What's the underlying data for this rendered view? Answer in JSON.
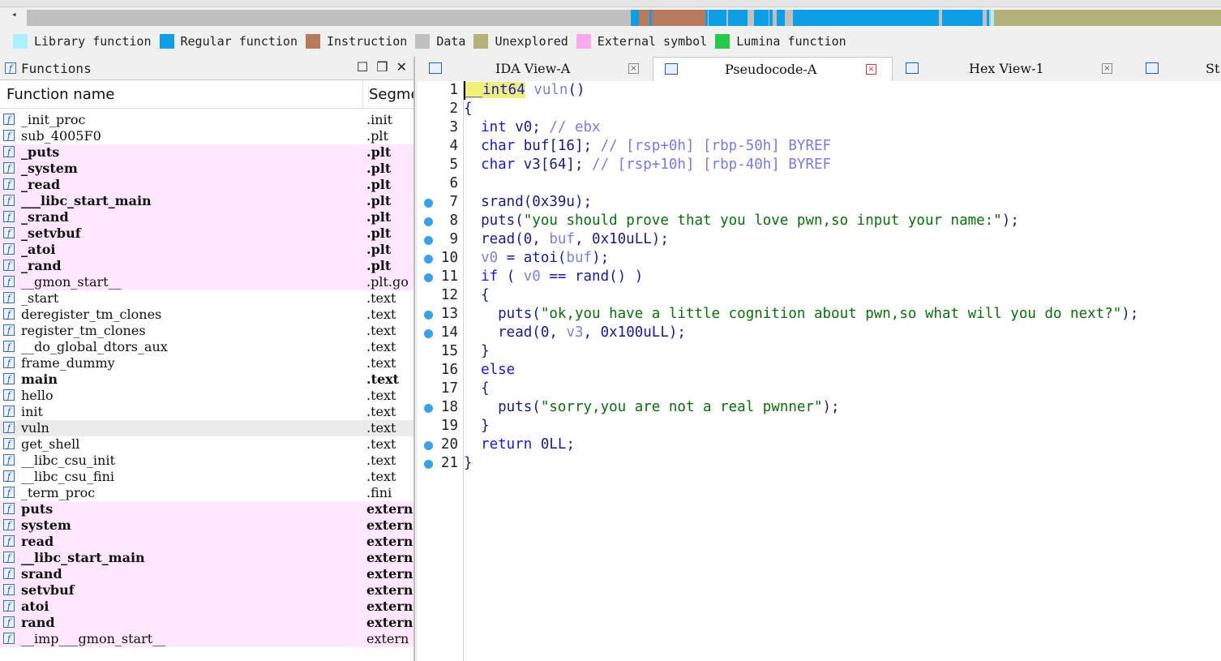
{
  "navbar": {
    "colors": {
      "library": "#aaf0f8",
      "regular": "#0d9ee6",
      "instruction": "#b87a5c",
      "data": "#c0c0c0",
      "unexplored": "#b5b17a",
      "external": "#ffa8f0",
      "lumina": "#2ac84a"
    }
  },
  "legend": [
    {
      "label": "Library function",
      "color": "#aaf0f8"
    },
    {
      "label": "Regular function",
      "color": "#0d9ee6"
    },
    {
      "label": "Instruction",
      "color": "#b87a5c"
    },
    {
      "label": "Data",
      "color": "#c0c0c0"
    },
    {
      "label": "Unexplored",
      "color": "#b5b17a"
    },
    {
      "label": "External symbol",
      "color": "#ffa8f0"
    },
    {
      "label": "Lumina function",
      "color": "#2ac84a"
    }
  ],
  "functions_panel": {
    "title": "Functions",
    "col_name": "Function name",
    "col_segment": "Segme",
    "rows": [
      {
        "name": "_init_proc",
        "seg": ".init",
        "style": ""
      },
      {
        "name": "sub_4005F0",
        "seg": ".plt",
        "style": ""
      },
      {
        "name": "_puts",
        "seg": ".plt",
        "style": "ext bold"
      },
      {
        "name": "_system",
        "seg": ".plt",
        "style": "ext bold"
      },
      {
        "name": "_read",
        "seg": ".plt",
        "style": "ext bold"
      },
      {
        "name": "___libc_start_main",
        "seg": ".plt",
        "style": "ext bold"
      },
      {
        "name": "_srand",
        "seg": ".plt",
        "style": "ext bold"
      },
      {
        "name": "_setvbuf",
        "seg": ".plt",
        "style": "ext bold"
      },
      {
        "name": "_atoi",
        "seg": ".plt",
        "style": "ext bold"
      },
      {
        "name": "_rand",
        "seg": ".plt",
        "style": "ext bold"
      },
      {
        "name": "__gmon_start__",
        "seg": ".plt.go",
        "style": "ext"
      },
      {
        "name": "_start",
        "seg": ".text",
        "style": ""
      },
      {
        "name": "deregister_tm_clones",
        "seg": ".text",
        "style": ""
      },
      {
        "name": "register_tm_clones",
        "seg": ".text",
        "style": ""
      },
      {
        "name": "__do_global_dtors_aux",
        "seg": ".text",
        "style": ""
      },
      {
        "name": "frame_dummy",
        "seg": ".text",
        "style": ""
      },
      {
        "name": "main",
        "seg": ".text",
        "style": "bold"
      },
      {
        "name": "hello",
        "seg": ".text",
        "style": ""
      },
      {
        "name": "init",
        "seg": ".text",
        "style": ""
      },
      {
        "name": "vuln",
        "seg": ".text",
        "style": "sel"
      },
      {
        "name": "get_shell",
        "seg": ".text",
        "style": ""
      },
      {
        "name": "__libc_csu_init",
        "seg": ".text",
        "style": ""
      },
      {
        "name": "__libc_csu_fini",
        "seg": ".text",
        "style": ""
      },
      {
        "name": "_term_proc",
        "seg": ".fini",
        "style": ""
      },
      {
        "name": "puts",
        "seg": "extern",
        "style": "ext bold"
      },
      {
        "name": "system",
        "seg": "extern",
        "style": "ext bold"
      },
      {
        "name": "read",
        "seg": "extern",
        "style": "ext bold"
      },
      {
        "name": "__libc_start_main",
        "seg": "extern",
        "style": "ext bold"
      },
      {
        "name": "srand",
        "seg": "extern",
        "style": "ext bold"
      },
      {
        "name": "setvbuf",
        "seg": "extern",
        "style": "ext bold"
      },
      {
        "name": "atoi",
        "seg": "extern",
        "style": "ext bold"
      },
      {
        "name": "rand",
        "seg": "extern",
        "style": "ext bold"
      },
      {
        "name": "__imp___gmon_start__",
        "seg": "extern",
        "style": "ext"
      }
    ]
  },
  "tabs": [
    {
      "label": "IDA View-A",
      "active": false
    },
    {
      "label": "Pseudocode-A",
      "active": true
    },
    {
      "label": "Hex View-1",
      "active": false
    },
    {
      "label": "St",
      "active": false
    }
  ],
  "pseudocode": {
    "lines": [
      {
        "n": "1",
        "dot": false,
        "tokens": [
          [
            "hl k",
            "__int64"
          ],
          [
            "v",
            " vuln"
          ],
          [
            "p",
            "()"
          ]
        ]
      },
      {
        "n": "2",
        "dot": false,
        "tokens": [
          [
            "p",
            "{"
          ]
        ]
      },
      {
        "n": "3",
        "dot": false,
        "tokens": [
          [
            "k",
            "  int"
          ],
          [
            "n",
            " v0; "
          ],
          [
            "c",
            "// ebx"
          ]
        ]
      },
      {
        "n": "4",
        "dot": false,
        "tokens": [
          [
            "k",
            "  char"
          ],
          [
            "n",
            " buf[16]; "
          ],
          [
            "c",
            "// [rsp+0h] [rbp-50h] BYREF"
          ]
        ]
      },
      {
        "n": "5",
        "dot": false,
        "tokens": [
          [
            "k",
            "  char"
          ],
          [
            "n",
            " v3[64]; "
          ],
          [
            "c",
            "// [rsp+10h] [rbp-40h] BYREF"
          ]
        ]
      },
      {
        "n": "6",
        "dot": false,
        "tokens": []
      },
      {
        "n": "7",
        "dot": true,
        "tokens": [
          [
            "n",
            "  srand(0x39u);"
          ]
        ]
      },
      {
        "n": "8",
        "dot": true,
        "tokens": [
          [
            "n",
            "  puts("
          ],
          [
            "s",
            "\"you should prove that you love pwn,so input your name:\""
          ],
          [
            "n",
            ");"
          ]
        ]
      },
      {
        "n": "9",
        "dot": true,
        "tokens": [
          [
            "n",
            "  read(0, "
          ],
          [
            "v",
            "buf"
          ],
          [
            "n",
            ", 0x10uLL);"
          ]
        ]
      },
      {
        "n": "10",
        "dot": true,
        "tokens": [
          [
            "v",
            "  v0"
          ],
          [
            "n",
            " = atoi("
          ],
          [
            "v",
            "buf"
          ],
          [
            "n",
            ");"
          ]
        ]
      },
      {
        "n": "11",
        "dot": true,
        "tokens": [
          [
            "k",
            "  if"
          ],
          [
            "n",
            " ( "
          ],
          [
            "v",
            "v0"
          ],
          [
            "n",
            " == rand() )"
          ]
        ]
      },
      {
        "n": "12",
        "dot": false,
        "tokens": [
          [
            "n",
            "  {"
          ]
        ]
      },
      {
        "n": "13",
        "dot": true,
        "tokens": [
          [
            "n",
            "    puts("
          ],
          [
            "s",
            "\"ok,you have a little cognition about pwn,so what will you do next?\""
          ],
          [
            "n",
            ");"
          ]
        ]
      },
      {
        "n": "14",
        "dot": true,
        "tokens": [
          [
            "n",
            "    read(0, "
          ],
          [
            "v",
            "v3"
          ],
          [
            "n",
            ", 0x100uLL);"
          ]
        ]
      },
      {
        "n": "15",
        "dot": false,
        "tokens": [
          [
            "n",
            "  }"
          ]
        ]
      },
      {
        "n": "16",
        "dot": false,
        "tokens": [
          [
            "k",
            "  else"
          ]
        ]
      },
      {
        "n": "17",
        "dot": false,
        "tokens": [
          [
            "n",
            "  {"
          ]
        ]
      },
      {
        "n": "18",
        "dot": true,
        "tokens": [
          [
            "n",
            "    puts("
          ],
          [
            "s",
            "\"sorry,you are not a real pwnner\""
          ],
          [
            "n",
            ");"
          ]
        ]
      },
      {
        "n": "19",
        "dot": false,
        "tokens": [
          [
            "n",
            "  }"
          ]
        ]
      },
      {
        "n": "20",
        "dot": true,
        "tokens": [
          [
            "k",
            "  return"
          ],
          [
            "n",
            " 0LL;"
          ]
        ]
      },
      {
        "n": "21",
        "dot": true,
        "tokens": [
          [
            "p",
            "}"
          ]
        ]
      }
    ]
  }
}
